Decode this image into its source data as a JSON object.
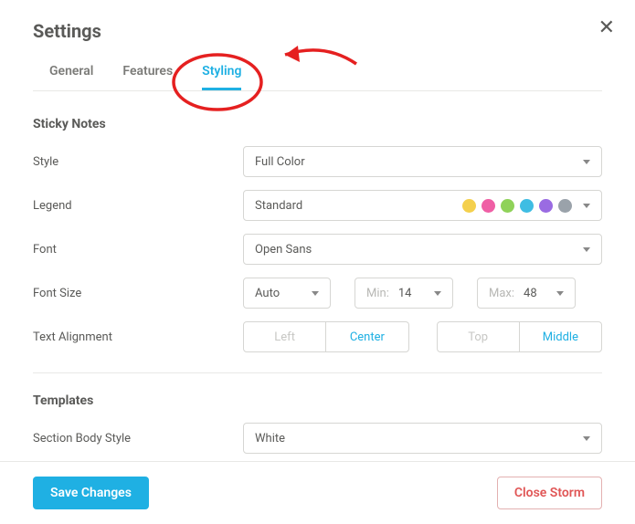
{
  "title": "Settings",
  "tabs": [
    {
      "id": "general",
      "label": "General",
      "active": false
    },
    {
      "id": "features",
      "label": "Features",
      "active": false
    },
    {
      "id": "styling",
      "label": "Styling",
      "active": true
    }
  ],
  "stickyNotes": {
    "heading": "Sticky Notes",
    "styleLabel": "Style",
    "styleValue": "Full Color",
    "legendLabel": "Legend",
    "legendValue": "Standard",
    "legendColors": [
      "#f4d04d",
      "#ef5fa5",
      "#8fd259",
      "#3fbde3",
      "#9a6be2",
      "#9aa2aa"
    ],
    "fontLabel": "Font",
    "fontValue": "Open Sans",
    "fontSizeLabel": "Font Size",
    "fontSizeAuto": "Auto",
    "minLabel": "Min:",
    "minValue": "14",
    "maxLabel": "Max:",
    "maxValue": "48",
    "alignLabel": "Text Alignment",
    "hAlign": {
      "options": [
        "Left",
        "Center"
      ],
      "active": "Center"
    },
    "vAlign": {
      "options": [
        "Top",
        "Middle"
      ],
      "active": "Middle"
    }
  },
  "templates": {
    "heading": "Templates",
    "bodyStyleLabel": "Section Body Style",
    "bodyStyleValue": "White"
  },
  "footer": {
    "save": "Save Changes",
    "close": "Close Storm"
  }
}
